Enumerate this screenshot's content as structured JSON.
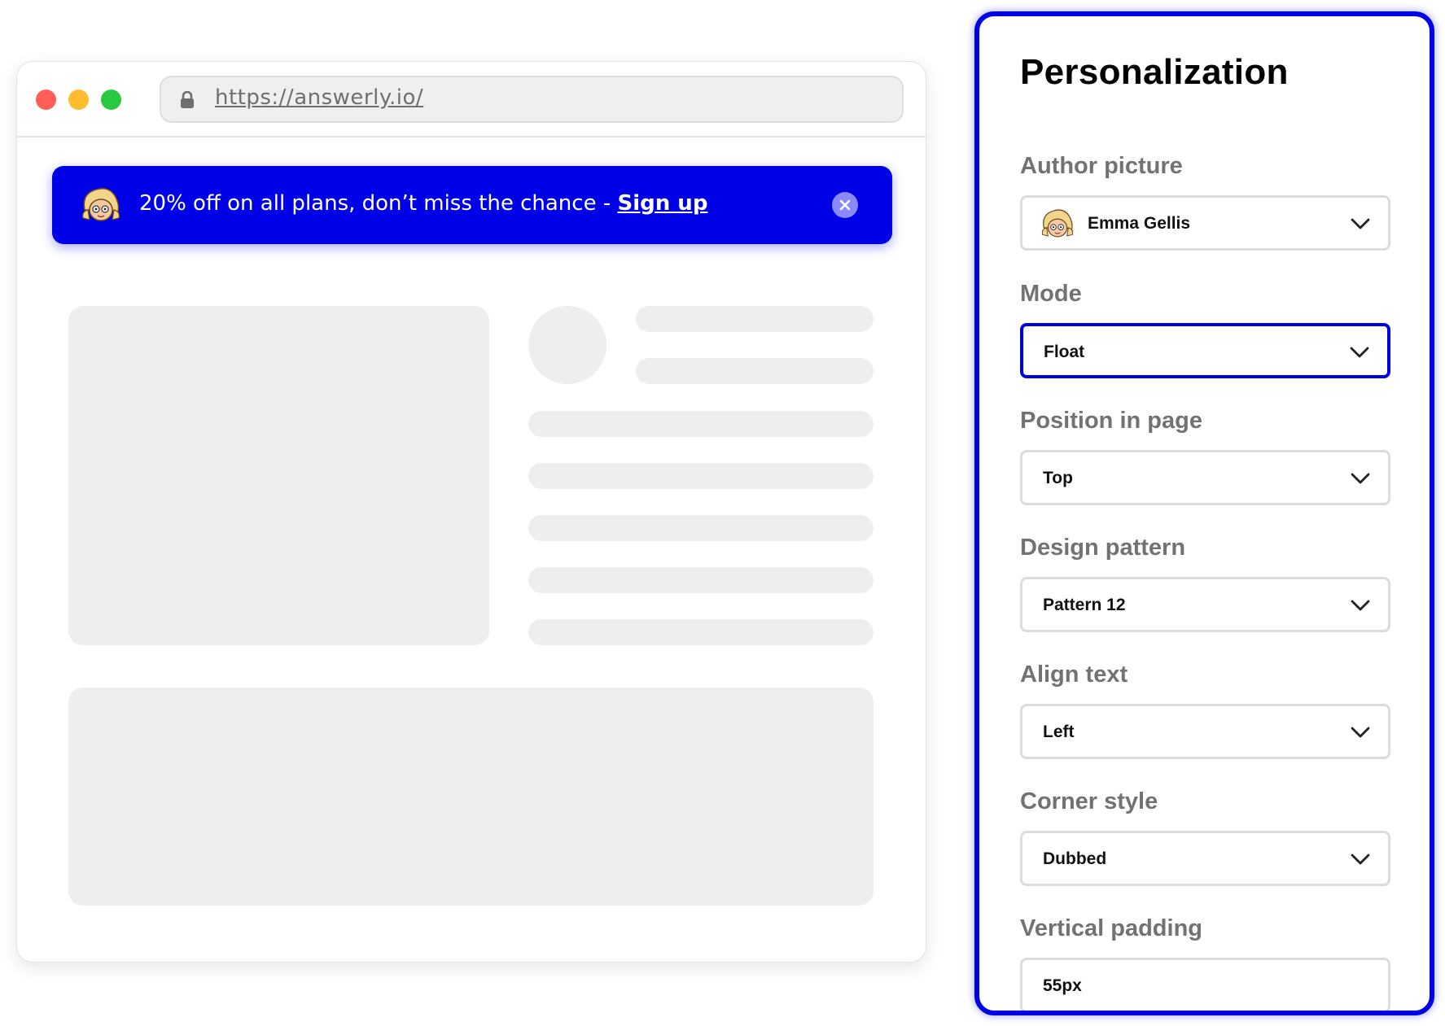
{
  "browser": {
    "url": "https://answerly.io/",
    "banner": {
      "text": "20% off on all plans, don’t miss the chance - ",
      "link_label": "Sign up"
    }
  },
  "panel": {
    "title": "Personalization",
    "fields": [
      {
        "label": "Author picture",
        "value": "Emma Gellis",
        "type": "select"
      },
      {
        "label": "Mode",
        "value": "Float",
        "type": "select",
        "active": true
      },
      {
        "label": "Position in page",
        "value": "Top",
        "type": "select"
      },
      {
        "label": "Design pattern",
        "value": "Pattern 12",
        "type": "select"
      },
      {
        "label": "Align text",
        "value": "Left",
        "type": "select"
      },
      {
        "label": "Corner style",
        "value": "Dubbed",
        "type": "select"
      },
      {
        "label": "Vertical padding",
        "value": "55px",
        "type": "input"
      }
    ]
  },
  "colors": {
    "accent": "#0000e6",
    "skeleton": "#eeeeee",
    "label": "#727272"
  },
  "icons": [
    "lock-icon",
    "avatar-icon",
    "close-icon",
    "chevron-down-icon"
  ]
}
